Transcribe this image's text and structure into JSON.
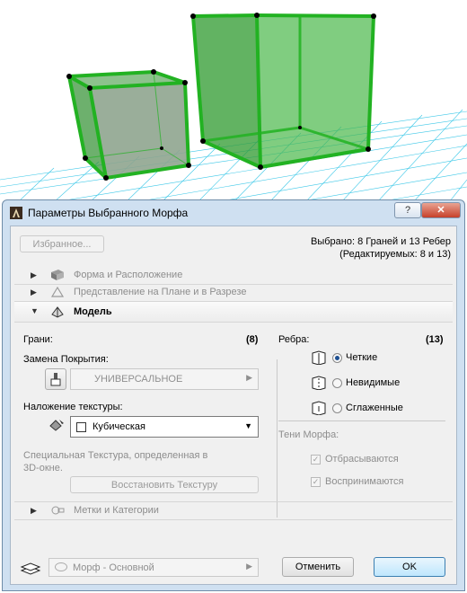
{
  "dialog": {
    "title": "Параметры Выбранного Морфа",
    "help_label": "?",
    "close_label": "✕"
  },
  "top": {
    "favorites_label": "Избранное...",
    "selection_line1": "Выбрано: 8 Граней и 13 Ребер",
    "selection_line2": "(Редактируемых: 8 и 13)"
  },
  "sections": {
    "shape": "Форма и Расположение",
    "plan": "Представление на Плане и в Разрезе",
    "model": "Модель",
    "tags": "Метки и Категории"
  },
  "faces": {
    "label": "Грани:",
    "count": "(8)",
    "override_label": "Замена Покрытия:",
    "override_value": "УНИВЕРСАЛЬНОЕ",
    "texture_label": "Наложение текстуры:",
    "texture_value": "Кубическая",
    "note": "Специальная Текстура, определенная в 3D-окне.",
    "reset_label": "Восстановить Текстуру"
  },
  "edges": {
    "label": "Ребра:",
    "count": "(13)",
    "options": [
      "Четкие",
      "Невидимые",
      "Сглаженные"
    ],
    "selected": "Четкие"
  },
  "shadows": {
    "label": "Тени Морфа:",
    "cast": "Отбрасываются",
    "receive": "Воспринимаются"
  },
  "footer": {
    "layer_value": "Морф - Основной",
    "cancel_label": "Отменить",
    "ok_label": "OK"
  },
  "colors": {
    "morph_green": "#22b222",
    "grid_cyan": "#3cc8e8",
    "dialog_frame": "#cfe0f1"
  }
}
